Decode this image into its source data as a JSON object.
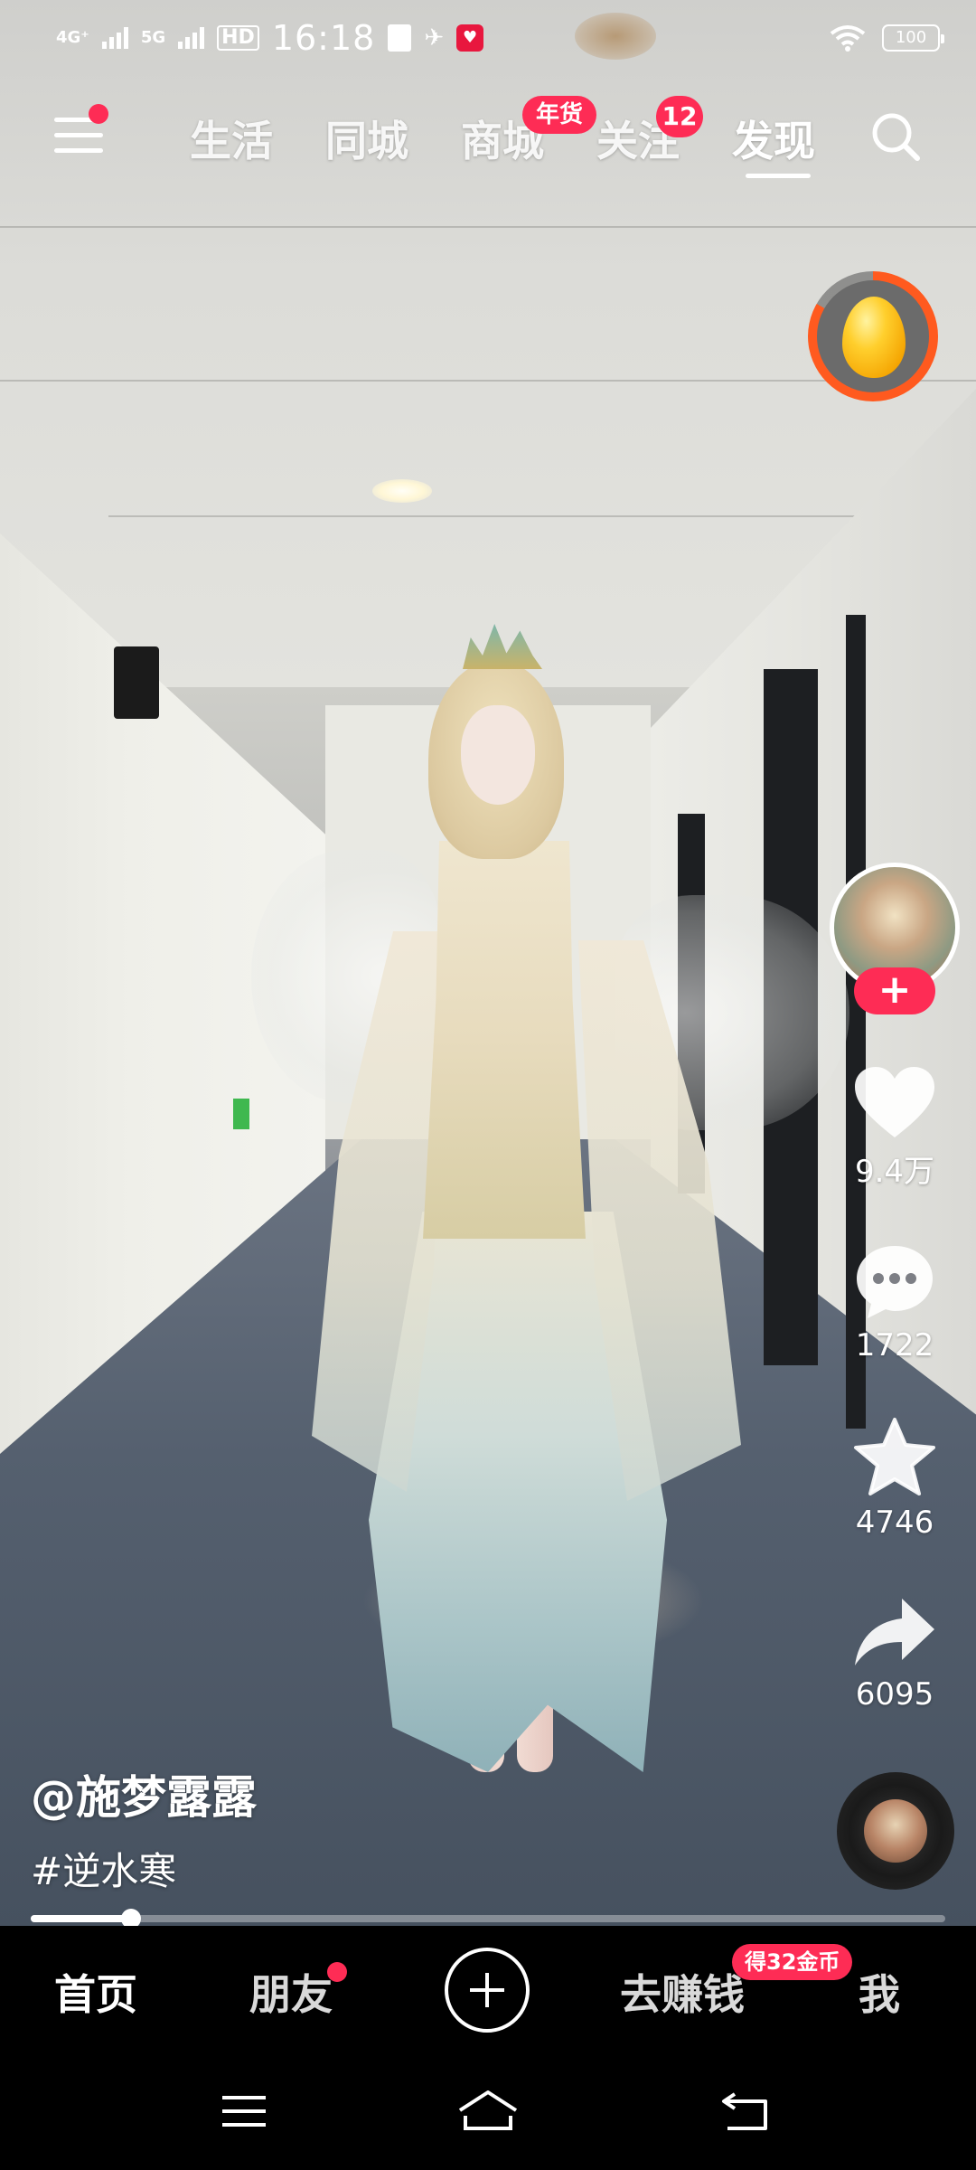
{
  "status_bar": {
    "network_1": "4G⁺",
    "network_2": "5G",
    "hd_label": "HD",
    "time": "16:18",
    "battery": "100"
  },
  "top_nav": {
    "tabs": [
      {
        "label": "生活"
      },
      {
        "label": "同城"
      },
      {
        "label": "商城",
        "badge": "年货"
      },
      {
        "label": "关注",
        "badge": "12"
      },
      {
        "label": "发现",
        "active": true
      }
    ]
  },
  "video": {
    "author": "@施梦露露",
    "hashtag": "#逆水寒",
    "progress": 0.11
  },
  "actions": {
    "likes": "9.4万",
    "comments": "1722",
    "favorites": "4746",
    "shares": "6095",
    "follow_symbol": "+"
  },
  "bottom_nav": {
    "tabs": [
      {
        "label": "首页",
        "active": true
      },
      {
        "label": "朋友"
      },
      {
        "label": "去赚钱",
        "badge": "得32金币"
      },
      {
        "label": "我"
      }
    ]
  },
  "colors": {
    "accent": "#fe2c55",
    "coin_ring": "#ff5a1f"
  }
}
